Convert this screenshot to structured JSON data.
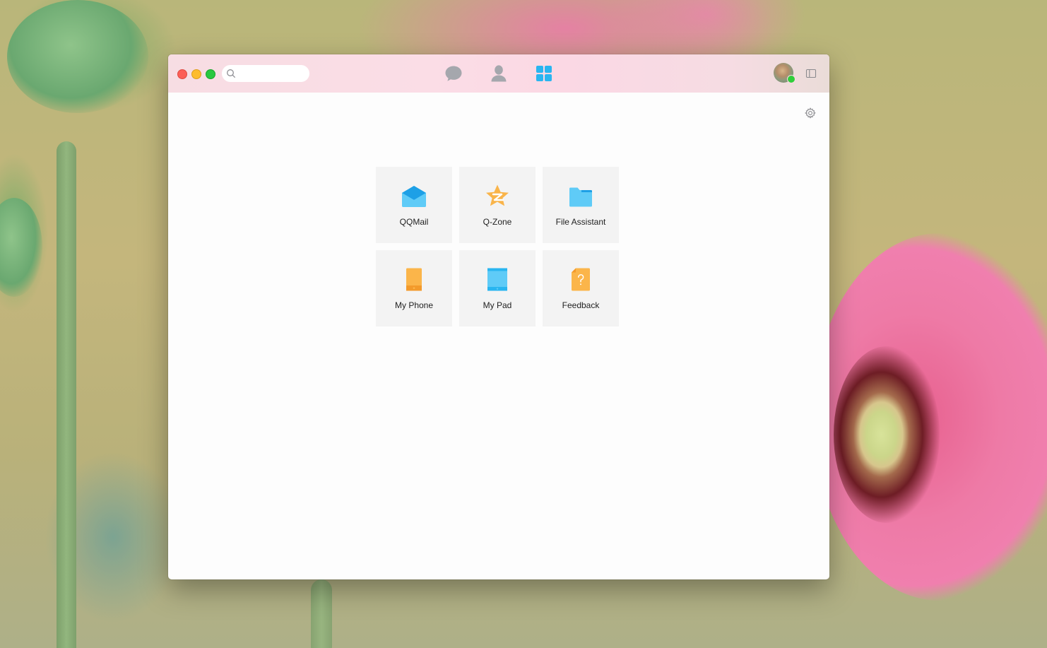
{
  "window": {
    "search": {
      "placeholder": "",
      "value": ""
    },
    "nav_tabs": [
      {
        "id": "messages",
        "icon": "chat-bubble-icon",
        "active": false
      },
      {
        "id": "contacts",
        "icon": "contact-person-icon",
        "active": false
      },
      {
        "id": "apps",
        "icon": "apps-grid-icon",
        "active": true
      }
    ],
    "avatar": {
      "status": "online",
      "status_color": "#2fcf3b"
    },
    "colors": {
      "accent": "#29b5f0",
      "inactive_icon": "#a5a7ad",
      "folder_blue": "#5fcbf7",
      "phone_orange": "#fbb54a"
    }
  },
  "apps": [
    {
      "label": "QQMail",
      "icon": "mail-envelope-icon"
    },
    {
      "label": "Q-Zone",
      "icon": "qzone-star-icon"
    },
    {
      "label": "File Assistant",
      "icon": "folder-icon"
    },
    {
      "label": "My Phone",
      "icon": "phone-icon"
    },
    {
      "label": "My Pad",
      "icon": "tablet-icon"
    },
    {
      "label": "Feedback",
      "icon": "feedback-document-icon"
    }
  ]
}
